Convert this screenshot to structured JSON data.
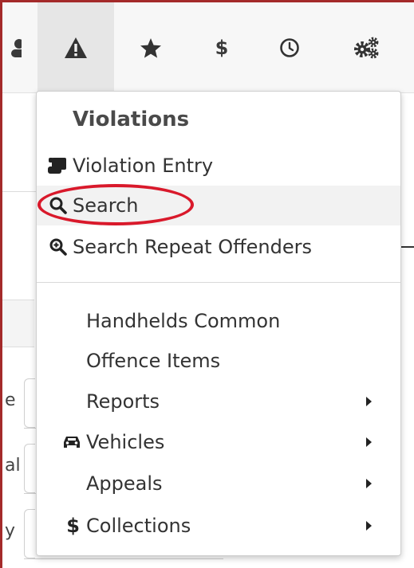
{
  "toolbar": {
    "icons": [
      "users-icon",
      "warning-icon",
      "star-icon",
      "dollar-icon",
      "clock-icon",
      "gears-icon"
    ],
    "active": "warning-icon",
    "glyphs": {
      "dollar": "$"
    }
  },
  "background": {
    "labels": [
      "e",
      "al",
      "y"
    ]
  },
  "menu": {
    "header": "Violations",
    "items": [
      {
        "label": "Violation Entry",
        "icon": "scroll-icon"
      },
      {
        "label": "Search",
        "icon": "search-icon",
        "state": "hover",
        "annotated": true
      },
      {
        "label": "Search Repeat Offenders",
        "icon": "search-plus-icon"
      },
      {
        "label": "Handhelds Common"
      },
      {
        "label": "Offence Items"
      },
      {
        "label": "Reports",
        "submenu": true
      },
      {
        "label": "Vehicles",
        "icon": "car-icon",
        "submenu": true
      },
      {
        "label": "Appeals",
        "submenu": true
      },
      {
        "label": "Collections",
        "icon": "dollar-icon",
        "glyph": "$",
        "submenu": true
      }
    ]
  },
  "colors": {
    "frame_border": "#a42a2a",
    "highlight_ring": "#d9192b",
    "hover_bg": "#f2f2f2",
    "active_toolbar_bg": "#e6e6e6"
  }
}
